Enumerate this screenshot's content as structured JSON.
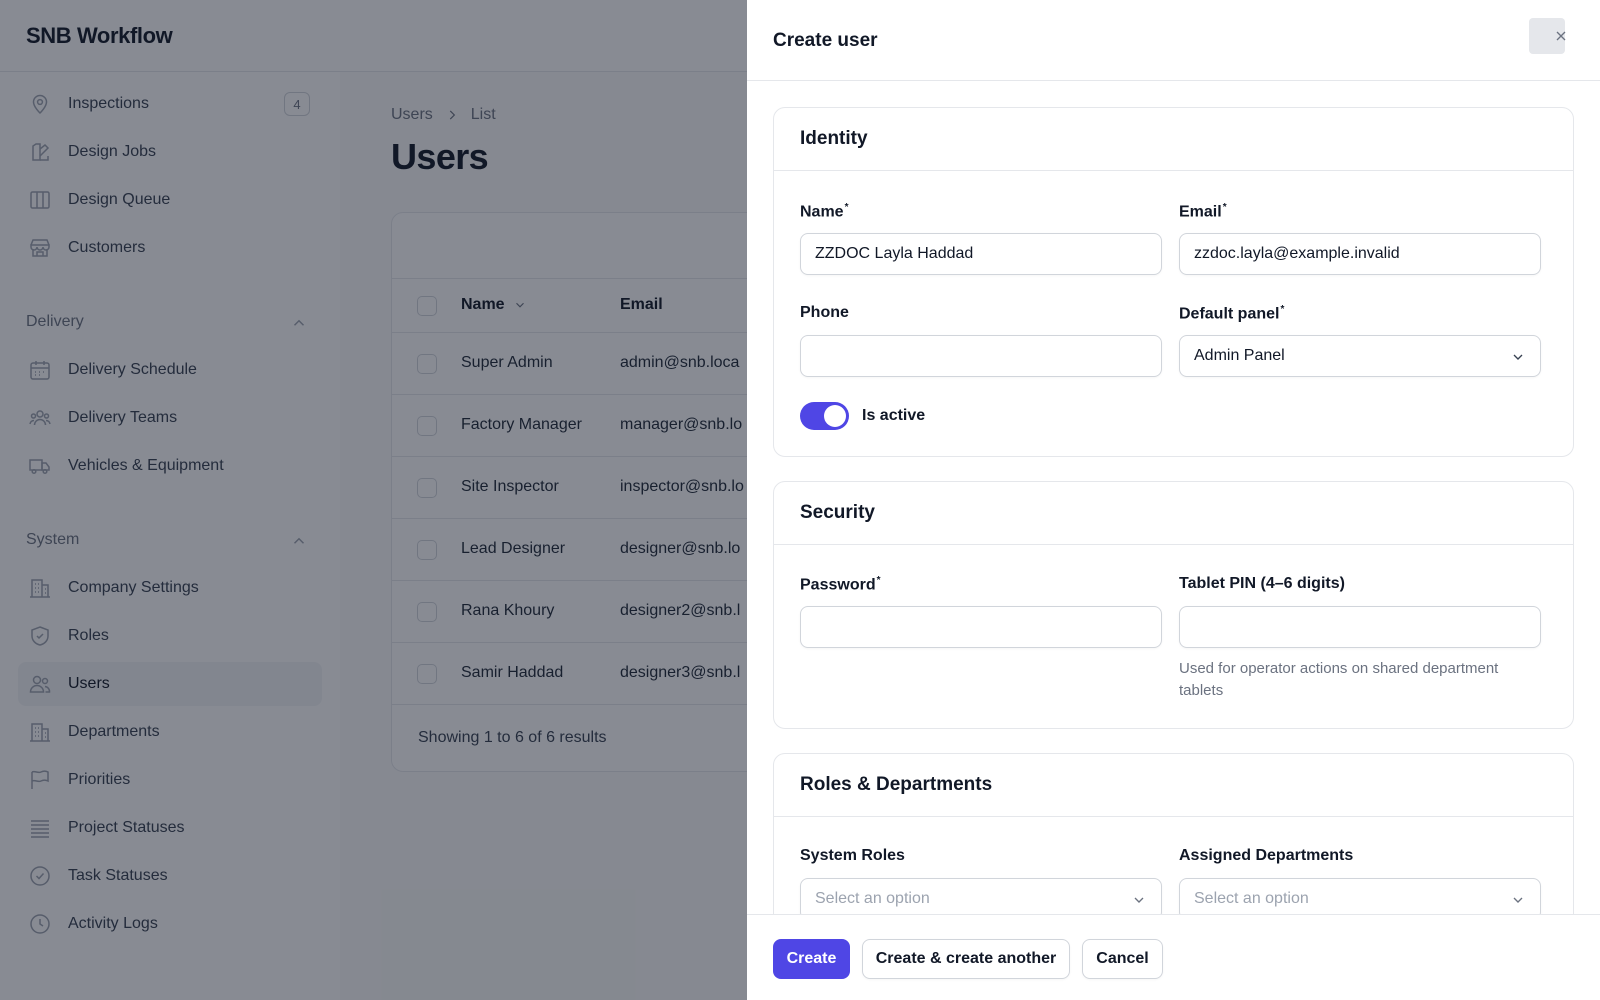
{
  "app": {
    "brand": "SNB Workflow"
  },
  "sidebar": {
    "items_top": [
      {
        "label": "Inspections",
        "icon": "map-pin-icon",
        "badge": "4"
      },
      {
        "label": "Design Jobs",
        "icon": "paint-brush-icon"
      },
      {
        "label": "Design Queue",
        "icon": "columns-icon"
      },
      {
        "label": "Customers",
        "icon": "storefront-icon"
      }
    ],
    "delivery_group": "Delivery",
    "delivery_items": [
      {
        "label": "Delivery Schedule",
        "icon": "calendar-icon"
      },
      {
        "label": "Delivery Teams",
        "icon": "user-group-icon"
      },
      {
        "label": "Vehicles & Equipment",
        "icon": "truck-icon"
      }
    ],
    "system_group": "System",
    "system_items": [
      {
        "label": "Company Settings",
        "icon": "building-icon"
      },
      {
        "label": "Roles",
        "icon": "shield-check-icon"
      },
      {
        "label": "Users",
        "icon": "users-icon"
      },
      {
        "label": "Departments",
        "icon": "office-building-icon"
      },
      {
        "label": "Priorities",
        "icon": "flag-icon"
      },
      {
        "label": "Project Statuses",
        "icon": "queue-list-icon"
      },
      {
        "label": "Task Statuses",
        "icon": "check-circle-icon"
      },
      {
        "label": "Activity Logs",
        "icon": "clock-icon"
      }
    ]
  },
  "main": {
    "breadcrumb": [
      "Users",
      "List"
    ],
    "title": "Users",
    "columns": [
      "Name",
      "Email"
    ],
    "rows": [
      {
        "name": "Super Admin",
        "email": "admin@snb.loca"
      },
      {
        "name": "Factory Manager",
        "email": "manager@snb.lo"
      },
      {
        "name": "Site Inspector",
        "email": "inspector@snb.lo"
      },
      {
        "name": "Lead Designer",
        "email": "designer@snb.lo"
      },
      {
        "name": "Rana Khoury",
        "email": "designer2@snb.l"
      },
      {
        "name": "Samir Haddad",
        "email": "designer3@snb.l"
      }
    ],
    "footer": "Showing 1 to 6 of 6 results"
  },
  "modal": {
    "title": "Create user",
    "identity": {
      "heading": "Identity",
      "name_label": "Name",
      "name_value": "ZZDOC Layla Haddad",
      "email_label": "Email",
      "email_value": "zzdoc.layla@example.invalid",
      "phone_label": "Phone",
      "phone_value": "",
      "default_panel_label": "Default panel",
      "default_panel_value": "Admin Panel",
      "is_active_label": "Is active",
      "is_active": true
    },
    "security": {
      "heading": "Security",
      "password_label": "Password",
      "pin_label": "Tablet PIN (4–6 digits)",
      "pin_hint": "Used for operator actions on shared department tablets"
    },
    "roles": {
      "heading": "Roles & Departments",
      "system_roles_label": "System Roles",
      "system_roles_placeholder": "Select an option",
      "departments_label": "Assigned Departments",
      "departments_placeholder": "Select an option"
    },
    "buttons": {
      "create": "Create",
      "create_another": "Create & create another",
      "cancel": "Cancel"
    },
    "accent_color": "#4f46e5"
  }
}
